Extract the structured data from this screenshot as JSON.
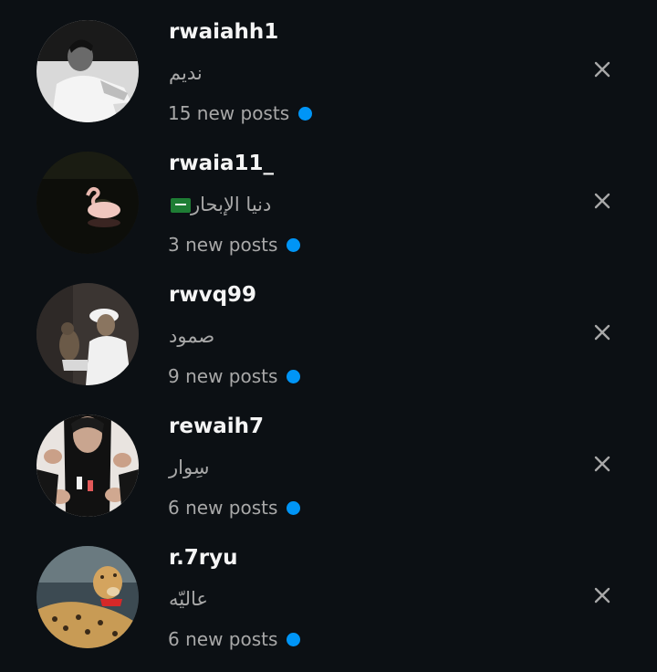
{
  "suggestions": [
    {
      "username": "rwaiahh1",
      "full_name": "نديم",
      "new_posts": "15 new posts",
      "avatar_icon": "avatar-man-white-shirt-bw-photo",
      "dismiss_icon": "close-icon"
    },
    {
      "username": "rwaia11_",
      "full_name": "دنيا الإبحار",
      "flag": "saudi-flag-emoji",
      "new_posts": "3 new posts",
      "avatar_icon": "avatar-swan-on-dark-water",
      "dismiss_icon": "close-icon"
    },
    {
      "username": "rwvq99",
      "full_name": "صمود",
      "new_posts": "9 new posts",
      "avatar_icon": "avatar-man-with-falcon",
      "dismiss_icon": "close-icon"
    },
    {
      "username": "rewaih7",
      "full_name": "سِوار",
      "new_posts": "6 new posts",
      "avatar_icon": "avatar-hands-lighting-cigarette",
      "dismiss_icon": "close-icon"
    },
    {
      "username": "r.7ryu",
      "full_name": "عاليّه",
      "new_posts": "6 new posts",
      "avatar_icon": "avatar-cheetah",
      "dismiss_icon": "close-icon"
    }
  ],
  "colors": {
    "background": "#0c1014",
    "username": "#f5f5f5",
    "secondary_text": "#a8a8a8",
    "unread_dot": "#0095f6"
  }
}
